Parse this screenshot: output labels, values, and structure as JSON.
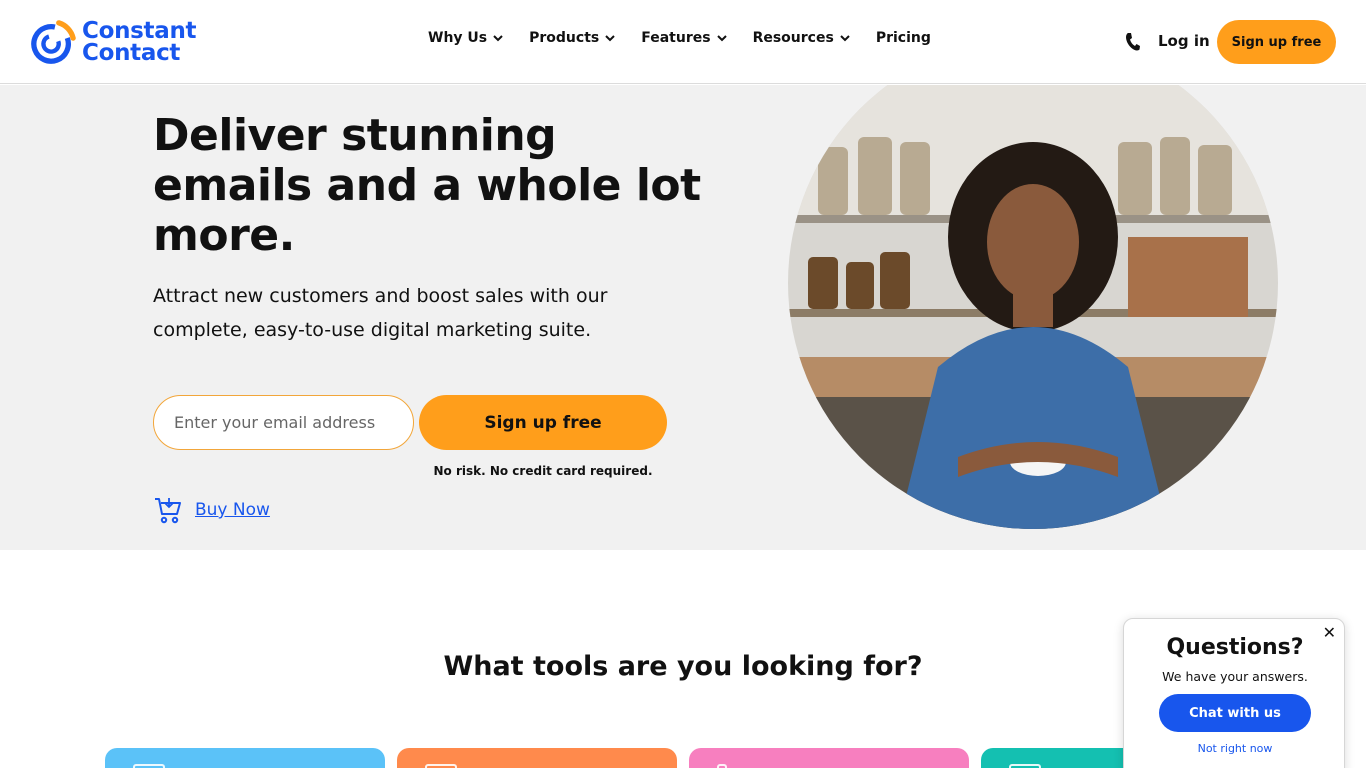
{
  "brand": {
    "name_line1": "Constant",
    "name_line2": "Contact",
    "color": "#1856ed",
    "accent": "#ff9e1b"
  },
  "nav": {
    "items": [
      {
        "label": "Why Us",
        "has_dropdown": true
      },
      {
        "label": "Products",
        "has_dropdown": true
      },
      {
        "label": "Features",
        "has_dropdown": true
      },
      {
        "label": "Resources",
        "has_dropdown": true
      },
      {
        "label": "Pricing",
        "has_dropdown": false
      }
    ],
    "phone_icon": "phone-icon",
    "login_label": "Log in",
    "signup_label": "Sign up free"
  },
  "hero": {
    "title": "Deliver stunning emails and a whole lot more.",
    "subtitle": "Attract new customers and boost sales with our complete, easy-to-use digital marketing suite.",
    "email_placeholder": "Enter your email address",
    "signup_label": "Sign up free",
    "disclaimer": "No risk. No credit card required.",
    "buy_now_label": "Buy Now",
    "buy_now_icon": "cart-icon",
    "background": "#f1f1f1"
  },
  "tools": {
    "title": "What tools are you looking for?",
    "card_colors": [
      "#5bc2f8",
      "#ff8a4c",
      "#f77fbf",
      "#14c0b1"
    ]
  },
  "chat": {
    "title": "Questions?",
    "subtitle": "We have your answers.",
    "button_label": "Chat with us",
    "dismiss_label": "Not right now",
    "close_label": "✕"
  }
}
